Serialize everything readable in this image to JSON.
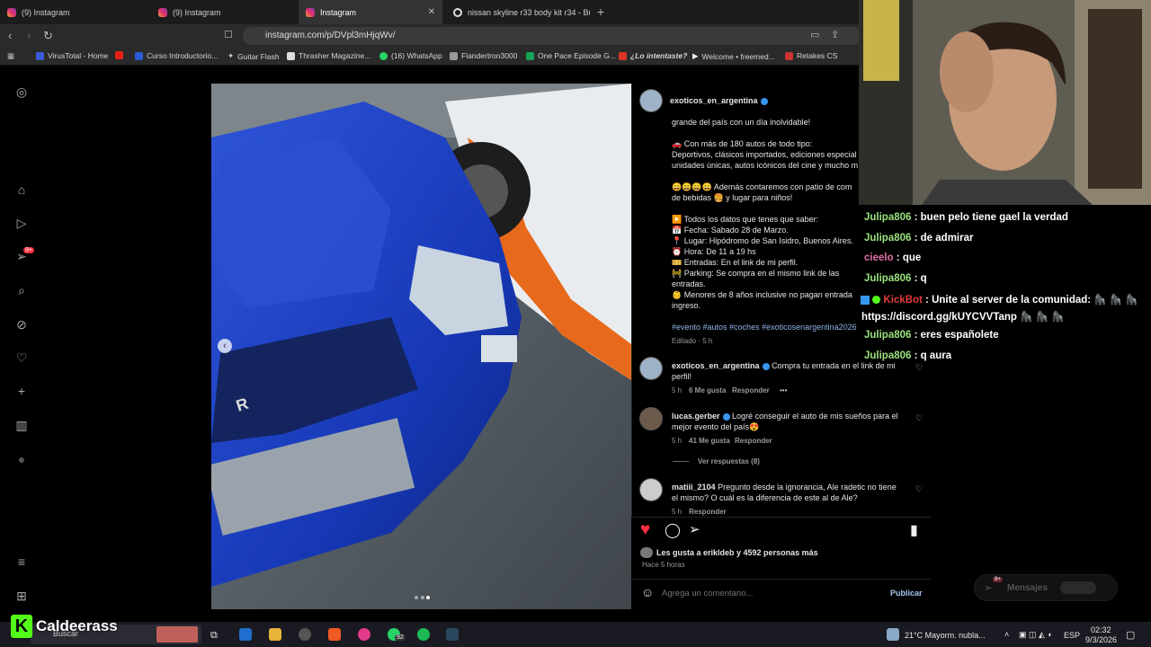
{
  "tabs": [
    {
      "label": "(9) Instagram",
      "active": false
    },
    {
      "label": "(9) Instagram",
      "active": false
    },
    {
      "label": "Instagram",
      "active": true
    },
    {
      "label": "nissan skyline r33 body kit r34 - Busc",
      "active": false
    }
  ],
  "address": {
    "url": "instagram.com/p/DVpl3mHjqWv/"
  },
  "bookmarks": [
    "VirusTotal - Home",
    "Curso Introductorio...",
    "Guitar Flash",
    "Thrasher Magazine...",
    "(16) WhatsApp",
    "Flandertron3000",
    "One Pace Episode G...",
    "¿Lo intentaste?",
    "Welcome • freemed...",
    "Retakes CS"
  ],
  "rail": {
    "notification_badge": "9+"
  },
  "post": {
    "author": "exoticos_en_argentina",
    "caption_lines": [
      "grande del país con un día inolvidable!",
      "",
      "🚗 Con más de 180 autos de todo tipo:",
      "Deportivos, clásicos importados, ediciones especial",
      "unidades únicas, autos icónicos del cine y mucho m",
      "",
      "😀😀😀😀 Además contaremos con patio de com",
      "de bebidas 🍔 y lugar para niños!",
      "",
      "▶️ Todos los datos que tenes que saber:",
      "📅 Fecha: Sabado 28 de Marzo.",
      "📍 Lugar: Hipódromo de San Isidro, Buenos Aires.",
      "⏰ Hora: De 11 a 19 hs",
      "🎫 Entradas: En el link de mi perfil.",
      "🚧 Parking: Se compra en el mismo link de las",
      "entradas.",
      "👶 Menores de 8 años inclusive no pagan entrada",
      "ingreso."
    ],
    "hashtags": "#evento #autos #coches #exoticosenargentina2026",
    "edited": "Editado · 5 h",
    "comments": [
      {
        "user": "exoticos_en_argentina",
        "text1": "Compra tu entrada en el link de mi",
        "text2": "perfil!",
        "time": "5 h",
        "likes": "6 Me gusta",
        "reply": "Responder",
        "more": "•••"
      },
      {
        "user": "lucas.gerber",
        "text1": "Logré conseguir el auto de mis sueños para el",
        "text2": "mejor evento del país😍",
        "time": "5 h",
        "likes": "41 Me gusta",
        "reply": "Responder",
        "view_replies": "Ver respuestas (8)"
      },
      {
        "user": "matiii_2104",
        "text1": "Pregunto desde la ignorancia, Ale radetic no tiene",
        "text2": "el mismo? O cuál es la diferencia de este al de Ale?",
        "time": "5 h",
        "reply": "Responder"
      }
    ],
    "liked_by": "Les gusta a erikldeb y 4592 personas más",
    "posted": "Hace 5 horas",
    "comment_placeholder": "Agrega un comentario...",
    "publish": "Publicar"
  },
  "messages": {
    "label": "Mensajes",
    "badge": "9+"
  },
  "chat": [
    {
      "user": "Julipa806",
      "msg": "buen pelo tiene gael la verdad"
    },
    {
      "user": "Julipa806",
      "msg": "de admirar"
    },
    {
      "user": "cieelo",
      "msg": "que"
    },
    {
      "user": "Julipa806",
      "msg": "q"
    },
    {
      "user": "KickBot",
      "msg": "Unite al server de la comunidad: 🦍 🦍 🦍",
      "msg2": "https://discord.gg/kUYCVVTanp 🦍 🦍 🦍"
    },
    {
      "user": "Julipa806",
      "msg": "eres españolete"
    },
    {
      "user": "Julipa806",
      "msg": "q aura"
    }
  ],
  "streamer": {
    "name": "Caldeerass"
  },
  "taskbar": {
    "search": "Buscar",
    "whatsapp_badge": "92",
    "weather": "21°C  Mayorm. nubla...",
    "lang": "ESP",
    "time": "02:32",
    "date": "9/3/2026"
  },
  "colors": {
    "chat_user": "#9be37e",
    "cieelo": "#e06fa4",
    "kickbot": "#e03c3c",
    "kick_green": "#53fc18",
    "like_red": "#ff3040",
    "link_blue": "#3797f0"
  }
}
